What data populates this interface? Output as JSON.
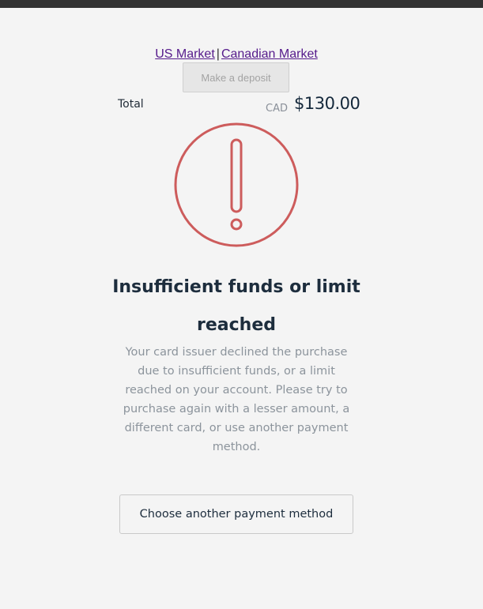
{
  "markets": {
    "us_label": "US Market",
    "separator": "|",
    "ca_label": "Canadian Market"
  },
  "deposit": {
    "label": "Make a deposit"
  },
  "summary": {
    "total_label": "Total",
    "currency": "CAD",
    "amount": "$130.00"
  },
  "alert": {
    "icon": "exclamation-circle-icon",
    "color": "#cd5c5c",
    "title_lines": [
      "Insufficient funds or limit",
      "reached"
    ],
    "description_lines": [
      "Your card issuer declined the purchase",
      "due to insufficient funds, or a limit",
      "reached on your account. Please try to",
      "purchase again with a lesser amount, a",
      "different card, or use another payment",
      "method."
    ]
  },
  "actions": {
    "choose_label": "Choose another payment method"
  }
}
